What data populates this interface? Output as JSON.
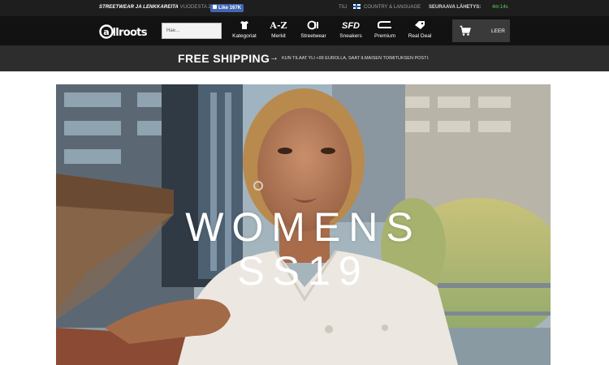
{
  "topbar": {
    "tagline_bold": "STREETWEAR JA LENKKAREITA",
    "tagline_rest": "VUODESTA 2003",
    "fb_like": "Like 167K",
    "account": "TILI",
    "country": "COUNTRY & LANGUAGE",
    "next_shipment_label": "SEURAAVA LÄHETYS:",
    "next_shipment_time": "4m:14s"
  },
  "nav": {
    "logo": "allroots",
    "search_placeholder": "Hae...",
    "items": [
      {
        "label": "Kategoriat",
        "icon": "tshirt-icon",
        "glyph": "👕"
      },
      {
        "label": "Merkit",
        "icon": "a-z-icon",
        "glyph": "A-Z"
      },
      {
        "label": "Streetwear",
        "icon": "allroots-logo-icon",
        "glyph": "@"
      },
      {
        "label": "Sneakers",
        "icon": "sfd-icon",
        "glyph": "SFD"
      },
      {
        "label": "Premium",
        "icon": "premium-icon",
        "glyph": "⌒"
      },
      {
        "label": "Real Deal",
        "icon": "tag-icon",
        "glyph": "🏷"
      }
    ],
    "cart_label": "LEER"
  },
  "shipping": {
    "title": "FREE SHIPPING",
    "subtitle": "KUN TILAAT YLI +99 EUROLLA, SAAT ILMAISEN TOIMITUKSEN POSTI."
  },
  "hero": {
    "title": "WOMENS",
    "subtitle": "SS19"
  },
  "colors": {
    "topbar": "#1e1e1e",
    "navbar": "#121212",
    "shipbar": "#2d2d2d",
    "fb": "#4267b2",
    "timer": "#5fd35f"
  }
}
